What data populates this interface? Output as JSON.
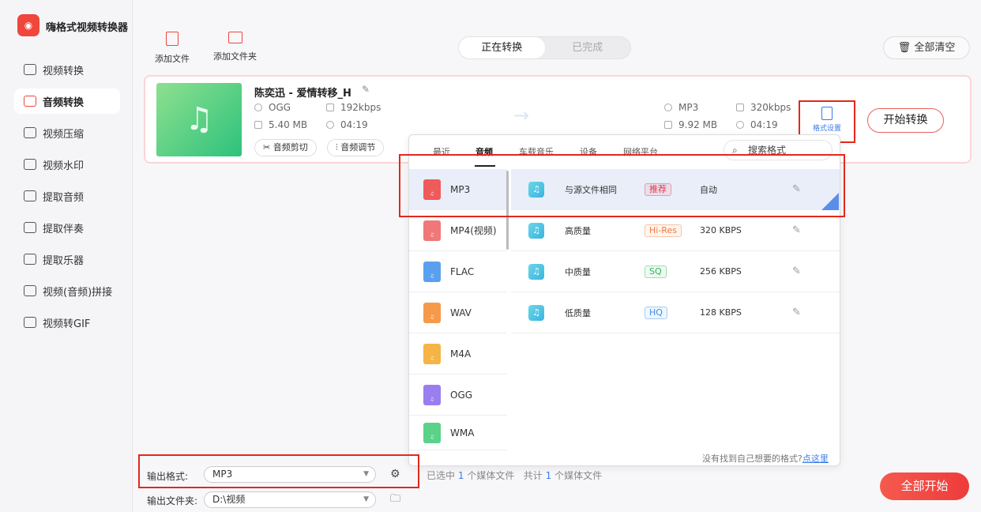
{
  "app": {
    "title": "嗨格式视频转换器"
  },
  "sidebar": {
    "items": [
      {
        "label": "视频转换",
        "active": false
      },
      {
        "label": "音频转换",
        "active": true
      },
      {
        "label": "视频压缩",
        "active": false
      },
      {
        "label": "视频水印",
        "active": false
      },
      {
        "label": "提取音频",
        "active": false
      },
      {
        "label": "提取伴奏",
        "active": false
      },
      {
        "label": "提取乐器",
        "active": false
      },
      {
        "label": "视频(音频)拼接",
        "active": false
      },
      {
        "label": "视频转GIF",
        "active": false
      }
    ]
  },
  "toolbar": {
    "add_file": "添加文件",
    "add_folder": "添加文件夹",
    "tab_converting": "正在转换",
    "tab_done": "已完成",
    "clear_all": "全部清空"
  },
  "file": {
    "name": "陈奕迅 - 爱情转移_H",
    "src_format": "OGG",
    "src_bitrate": "192kbps",
    "src_size": "5.40 MB",
    "src_duration": "04:19",
    "dst_format": "MP3",
    "dst_bitrate": "320kbps",
    "dst_size": "9.92 MB",
    "dst_duration": "04:19",
    "cut": "音频剪切",
    "adjust": "音频调节",
    "format_settings": "格式设置",
    "start": "开始转换"
  },
  "panel": {
    "tabs": [
      "最近",
      "音频",
      "车载音乐",
      "设备",
      "网络平台"
    ],
    "active_tab": 1,
    "search_placeholder": "搜索格式",
    "formats": [
      {
        "label": "MP3",
        "color": "#ef5a5a"
      },
      {
        "label": "MP4(视频)",
        "color": "#f07878"
      },
      {
        "label": "FLAC",
        "color": "#5aa0ef"
      },
      {
        "label": "WAV",
        "color": "#f59a4a"
      },
      {
        "label": "M4A",
        "color": "#f5b445"
      },
      {
        "label": "OGG",
        "color": "#9a7ef0"
      },
      {
        "label": "WMA",
        "color": "#5ad28a"
      }
    ],
    "qualities": [
      {
        "name": "与源文件相同",
        "badge": "推荐",
        "badge_color": "#e8384f",
        "value": "自动"
      },
      {
        "name": "高质量",
        "badge": "Hi-Res",
        "badge_color": "#f07a3a",
        "value": "320 KBPS"
      },
      {
        "name": "中质量",
        "badge": "SQ",
        "badge_color": "#28b85a",
        "value": "256 KBPS"
      },
      {
        "name": "低质量",
        "badge": "HQ",
        "badge_color": "#3a8ee8",
        "value": "128 KBPS"
      }
    ],
    "not_found": "没有找到自己想要的格式?",
    "click_here": "点这里"
  },
  "footer": {
    "output_format_label": "输出格式:",
    "output_format": "MP3",
    "output_folder_label": "输出文件夹:",
    "output_folder": "D:\\视频",
    "selected_pre": "已选中",
    "selected_count": "1",
    "selected_post": "个媒体文件",
    "total_pre": "共计",
    "total_count": "1",
    "total_post": "个媒体文件",
    "start_all": "全部开始"
  }
}
